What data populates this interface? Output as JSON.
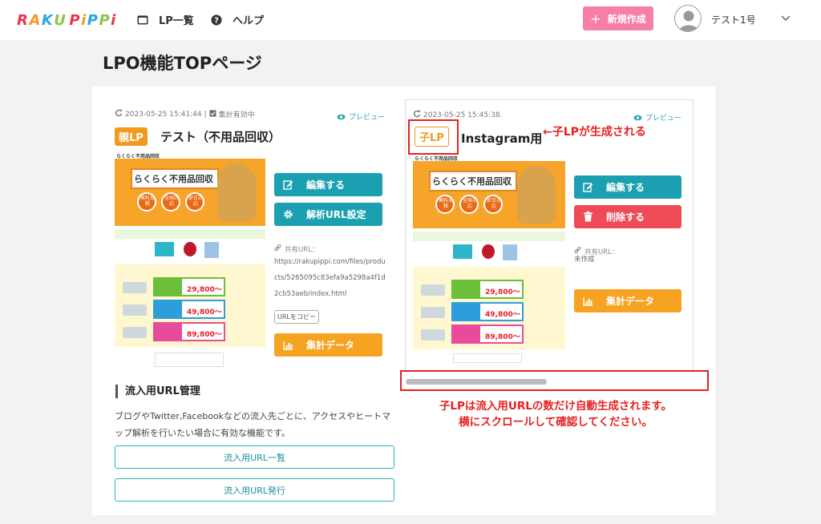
{
  "header": {
    "logo_text": "RAKU PiPPi",
    "nav": [
      {
        "label": "LP一覧",
        "icon": "window-icon"
      },
      {
        "label": "ヘルプ",
        "icon": "question-circle-icon"
      }
    ],
    "new_button_label": "新規作成",
    "user_name": "テスト1号"
  },
  "page_title": "LPO機能TOPページ",
  "parent_lp": {
    "meta_date": "2023-05-25 15:41:44",
    "meta_status": "集計有効中",
    "preview_label": "プレビュー",
    "badge": "親LP",
    "title": "テスト（不用品回収）",
    "thumb_headline": "らくらく不用品回収",
    "thumb_circles": [
      "無料見積",
      "全国対応",
      "即日対応"
    ],
    "thumb_prices": [
      "29,800〜",
      "49,800〜",
      "89,800〜"
    ],
    "buttons": {
      "edit": "編集する",
      "analytics_url": "解析URL設定",
      "stats": "集計データ"
    },
    "share_label": "共有URL：",
    "share_url": "https://rakupippi.com/files/products/5265095c83efa9a5298a4f1d2cb53aeb/index.html",
    "copy_label": "URLをコピー"
  },
  "inflow": {
    "section_title": "流入用URL管理",
    "description": "ブログやTwitter,Facebookなどの流入先ごとに、アクセスやヒートマップ解析を行いたい場合に有効な機能です。",
    "list_button": "流入用URL一覧",
    "issue_button": "流入用URL発行"
  },
  "child_lp": {
    "meta_date": "2023-05-25 15:45:38.",
    "preview_label": "プレビュー",
    "badge": "子LP",
    "title": "Instagram用",
    "thumb_headline": "らくらく不用品回収",
    "thumb_circles": [
      "無料見積",
      "全国対応",
      "即日対応"
    ],
    "thumb_prices": [
      "29,800〜",
      "49,800〜",
      "89,800〜"
    ],
    "buttons": {
      "edit": "編集する",
      "delete": "削除する",
      "stats": "集計データ"
    },
    "share_label": "共有URL：",
    "share_value": "未作成"
  },
  "annotations": {
    "arrow_note": "←子LPが生成される",
    "bottom_note_line1": "子LPは流入用URLの数だけ自動生成されます。",
    "bottom_note_line2": "横にスクロールして確認してください。"
  },
  "colors": {
    "teal": "#1aa0b0",
    "red": "#ee4b56",
    "orange": "#f6a321",
    "pink": "#f77fa7",
    "annotation_red": "#e62222",
    "parent_badge": "#f29a1f"
  }
}
